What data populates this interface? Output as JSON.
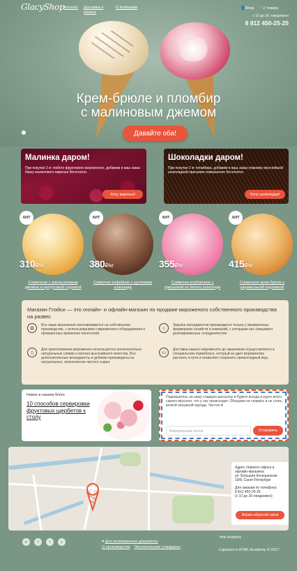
{
  "header": {
    "logo": "GlacyShop",
    "nav": [
      {
        "label": "Каталог"
      },
      {
        "label": "Доставка и оплата"
      },
      {
        "label": "О Компании"
      }
    ],
    "login_label": "Вход",
    "cart_label": "2 товара",
    "hours": "с 10 до 20, ежедневно",
    "phone": "8 812 450-25-25"
  },
  "hero": {
    "title_line1": "Крем-брюле и пломбир",
    "title_line2": "с малиновым джемом",
    "button": "Давайте оба!"
  },
  "promos": [
    {
      "title": "Малинка даром!",
      "text": "При покупке 2 кг любого фруктового мороженого, добавим в ваш заказ банку малинового варенья бесплатно.",
      "button": "Хочу варенья!"
    },
    {
      "title": "Шоколадки даром!",
      "text": "При покупке 2 кг пломбира, добавим в ваш заказ упаковку вкуснейшей шоколадной присыпки совершенно бесплатно.",
      "button": "Хочу шоколадки!"
    }
  ],
  "products": [
    {
      "badge": "ХИТ",
      "price": "310",
      "unit": "₽/кг",
      "name": "Сливочное с апельсиновым джемом и цитрусовой стружкой"
    },
    {
      "badge": "ХИТ",
      "price": "380",
      "unit": "₽/кг",
      "name": "Сливочно-кофейное с кусочками шоколада"
    },
    {
      "badge": "ХИТ",
      "price": "355",
      "unit": "₽/кг",
      "name": "Сливочно-клубничное с присыпкой из белого шоколада"
    },
    {
      "badge": "ХИТ",
      "price": "415",
      "unit": "₽/кг",
      "name": "Сливочное крем-брюле с карамельной подливкой"
    }
  ],
  "info": {
    "heading": "Магазин Глэйси — это онлайн- и офлайн-магазин по продаже мороженого собственного производства на развес",
    "features": [
      {
        "icon": "ice-cream-icon",
        "text": "Все наше мороженое изготавливается на собственном производстве, с использованием современного оборудования и проверенных временем технологий."
      },
      {
        "icon": "farm-icon",
        "text": "Закупка ингредиентов производится только у проверенных фермерских хозяйств и компаний, с которыми нас связывают долговременные сотрудничество."
      },
      {
        "icon": "milk-icon",
        "text": "Для приготовления мороженого используются исключительно натуральные сливки и молоко высочайшего качества. Все дополнительные ингредиенты и добавки произведены из натуральных, экологически чистого сырья."
      },
      {
        "icon": "truck-icon",
        "text": "Доставка нашего мороженого до заказчиков осуществляется в специальном термобоксе, который не дает мороженому растаять в пути и позволяет сохранить превосходный вкус."
      }
    ]
  },
  "blog": {
    "label": "Новое в нашем блоге",
    "title": "10 способов сервировки фруктовых щербетов к столу"
  },
  "subscribe": {
    "text": "Подпишитесь на нашу сладкую рассылку и будете всегда в курсе всего самого вкусного, что у нас происходит. Обещаем не спамить и не слать всякой ненужной ерунды. Честно ♥",
    "placeholder": "Электронная почта",
    "button": "Отправить"
  },
  "map": {
    "address_label": "Адрес главного офиса и офлайн-магазина:",
    "address": "ул. Большая Конюшенная 19/8, Санкт-Петербург",
    "order_label": "Для заказов по телефону:",
    "order_phone": "8 812 450-25-25",
    "order_hours": "(с 10 до 20 ежедневно)",
    "button": "Форма обратной связи"
  },
  "footer": {
    "social": [
      "vk-icon",
      "twitter-icon",
      "facebook-icon",
      "vine-icon"
    ],
    "heart_link": "Для посвященных документы",
    "link2": "О производстве",
    "link3": "Экологические стандарты",
    "academy": "html academy",
    "made": "Сделано в HTML Academy © 2017"
  },
  "colors": {
    "accent": "#e8553c",
    "background": "#7a9685",
    "info_bg": "#f4ead7"
  }
}
